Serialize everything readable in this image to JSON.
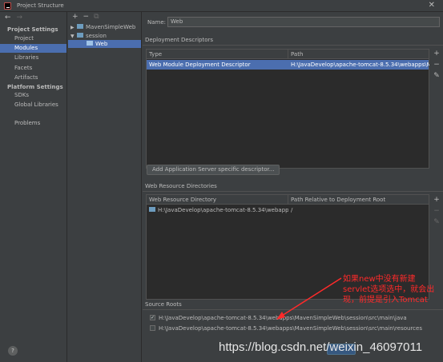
{
  "window": {
    "title": "Project Structure",
    "close": "✕"
  },
  "sidebar": {
    "nav_back": "←",
    "nav_forward": "→",
    "sections": [
      {
        "title": "Project Settings"
      },
      {
        "title": "Platform Settings"
      }
    ],
    "project_items": [
      {
        "label": "Project"
      },
      {
        "label": "Modules"
      },
      {
        "label": "Libraries"
      },
      {
        "label": "Facets"
      },
      {
        "label": "Artifacts"
      }
    ],
    "platform_items": [
      {
        "label": "SDKs"
      },
      {
        "label": "Global Libraries"
      }
    ],
    "problems": "Problems",
    "help": "?"
  },
  "tree": {
    "add": "+",
    "remove": "−",
    "copy": "⧉",
    "nodes": [
      {
        "label": "MavenSimpleWeb",
        "arrow": "▶"
      },
      {
        "label": "session",
        "arrow": "▼"
      },
      {
        "label": "Web",
        "arrow": ""
      }
    ]
  },
  "main": {
    "name_label": "Name:",
    "name_value": "Web",
    "deployment": {
      "title": "Deployment Descriptors",
      "columns": [
        "Type",
        "Path"
      ],
      "rows": [
        {
          "type": "Web Module Deployment Descriptor",
          "path": "H:\\JavaDevelop\\apache-tomcat-8.5.34\\webapps\\MavenSi"
        }
      ],
      "add_server_button": "Add Application Server specific descriptor..."
    },
    "web_resources": {
      "title": "Web Resource Directories",
      "columns": [
        "Web Resource Directory",
        "Path Relative to Deployment Root"
      ],
      "rows": [
        {
          "dir": "H:\\JavaDevelop\\apache-tomcat-8.5.34\\webapps\\M...",
          "rel": "/"
        }
      ]
    },
    "source_roots": {
      "title": "Source Roots",
      "items": [
        {
          "checked": true,
          "check_mark": "✓",
          "path": "H:\\JavaDevelop\\apache-tomcat-8.5.34\\webapps\\MavenSimpleWeb\\session\\src\\main\\java"
        },
        {
          "checked": false,
          "check_mark": "",
          "path": "H:\\JavaDevelop\\apache-tomcat-8.5.34\\webapps\\MavenSimpleWeb\\session\\src\\main\\resources"
        }
      ]
    },
    "tools": {
      "add": "+",
      "remove": "−",
      "edit": "✎"
    }
  },
  "annotation": {
    "text": "如果new中没有新建servlet选项选中，就会出现，前提是引入Tomcat",
    "color": "#ff2a2a"
  },
  "watermark": "https://blog.csdn.net/weixin_46097011",
  "colors": {
    "selection": "#4b6eaf",
    "background": "#3c3f41",
    "table_bg": "#2b2b2b"
  }
}
